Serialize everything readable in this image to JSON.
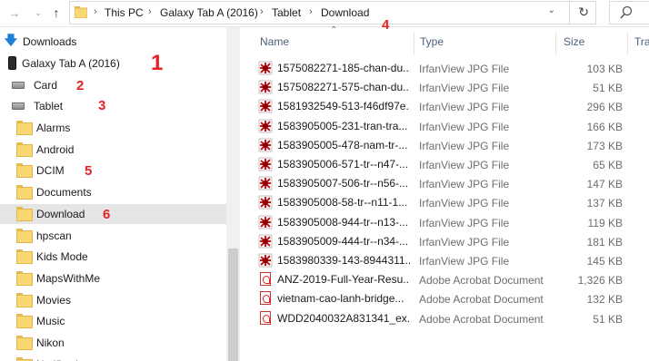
{
  "address": {
    "crumbs": [
      "This PC",
      "Galaxy Tab A (2016)",
      "Tablet",
      "Download"
    ]
  },
  "nav": {
    "downloads": "Downloads",
    "device": "Galaxy Tab A (2016)",
    "card": "Card",
    "tablet": "Tablet",
    "folders": [
      "Alarms",
      "Android",
      "DCIM",
      "Documents",
      "Download",
      "hpscan",
      "Kids Mode",
      "MapsWithMe",
      "Movies",
      "Music",
      "Nikon",
      "Notifications"
    ]
  },
  "annotations": [
    "1",
    "2",
    "3",
    "4",
    "5",
    "6"
  ],
  "columns": {
    "name": "Name",
    "type": "Type",
    "size": "Size",
    "extra": "Tra"
  },
  "files": [
    {
      "name": "1575082271-185-chan-du...",
      "type": "IrfanView JPG File",
      "size": "103 KB",
      "icon": "irfanview-jpg-icon"
    },
    {
      "name": "1575082271-575-chan-du...",
      "type": "IrfanView JPG File",
      "size": "51 KB",
      "icon": "irfanview-jpg-icon"
    },
    {
      "name": "1581932549-513-f46df97e...",
      "type": "IrfanView JPG File",
      "size": "296 KB",
      "icon": "irfanview-jpg-icon"
    },
    {
      "name": "1583905005-231-tran-tra...",
      "type": "IrfanView JPG File",
      "size": "166 KB",
      "icon": "irfanview-jpg-icon"
    },
    {
      "name": "1583905005-478-nam-tr-...",
      "type": "IrfanView JPG File",
      "size": "173 KB",
      "icon": "irfanview-jpg-icon"
    },
    {
      "name": "1583905006-571-tr--n47-...",
      "type": "IrfanView JPG File",
      "size": "65 KB",
      "icon": "irfanview-jpg-icon"
    },
    {
      "name": "1583905007-506-tr--n56-...",
      "type": "IrfanView JPG File",
      "size": "147 KB",
      "icon": "irfanview-jpg-icon"
    },
    {
      "name": "1583905008-58-tr--n11-1...",
      "type": "IrfanView JPG File",
      "size": "137 KB",
      "icon": "irfanview-jpg-icon"
    },
    {
      "name": "1583905008-944-tr--n13-...",
      "type": "IrfanView JPG File",
      "size": "119 KB",
      "icon": "irfanview-jpg-icon"
    },
    {
      "name": "1583905009-444-tr--n34-...",
      "type": "IrfanView JPG File",
      "size": "181 KB",
      "icon": "irfanview-jpg-icon"
    },
    {
      "name": "1583980339-143-8944311...",
      "type": "IrfanView JPG File",
      "size": "145 KB",
      "icon": "irfanview-jpg-icon"
    },
    {
      "name": "ANZ-2019-Full-Year-Resu...",
      "type": "Adobe Acrobat Document",
      "size": "1,326 KB",
      "icon": "pdf-icon"
    },
    {
      "name": "vietnam-cao-lanh-bridge...",
      "type": "Adobe Acrobat Document",
      "size": "132 KB",
      "icon": "pdf-icon"
    },
    {
      "name": "WDD2040032A831341_ex...",
      "type": "Adobe Acrobat Document",
      "size": "51 KB",
      "icon": "pdf-icon"
    }
  ],
  "colors": {
    "annotation": "#e52222",
    "selected": "#e5e5e5",
    "header": "#4c607a"
  }
}
